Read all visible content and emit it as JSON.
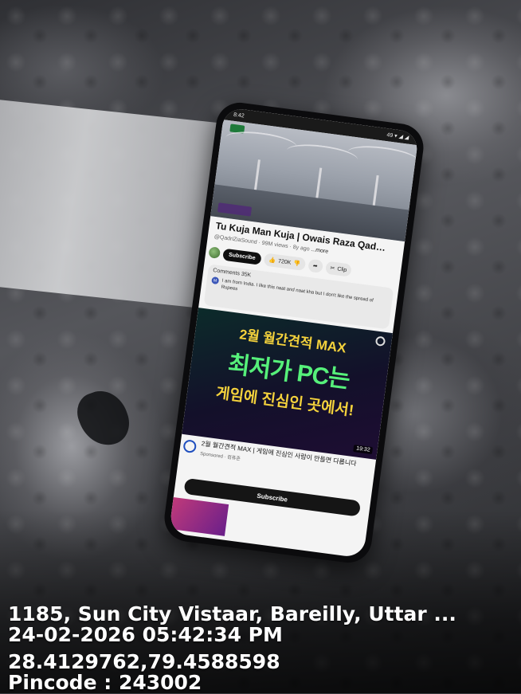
{
  "phone": {
    "status_time": "8:42",
    "status_right": "49 ▾ ◢ ◢",
    "video": {
      "title": "Tu Kuja Man Kuja | Owais Raza Qad…",
      "channel_meta": "@QadriZiaSound · 99M views · 8y ago",
      "more": "...more",
      "subscribe_label": "Subscribe",
      "like_count": "720K",
      "clip_label": "Clip"
    },
    "comments": {
      "header": "Comments 35K",
      "avatar_letter": "M",
      "text": "I am from India. I like this naat and naat kha but I don't like the spread of Rupees"
    },
    "ad": {
      "line1": "2월 월간견적 MAX",
      "line2": "최저가 PC는",
      "line3": "게임에 진심인 곳에서!",
      "duration": "19:32",
      "title": "2월 월간견적 MAX | 게임에 진심인 사람이 만들면 다릅니다",
      "sponsor": "Sponsored · 컴퓨존",
      "subscribe_label": "Subscribe"
    }
  },
  "geotag": {
    "address": "1185, Sun City Vistaar, Bareilly, Uttar ...",
    "datetime": "24-02-2026 05:42:34 PM",
    "coordinates": "28.4129762,79.4588598",
    "pincode": "Pincode : 243002"
  }
}
